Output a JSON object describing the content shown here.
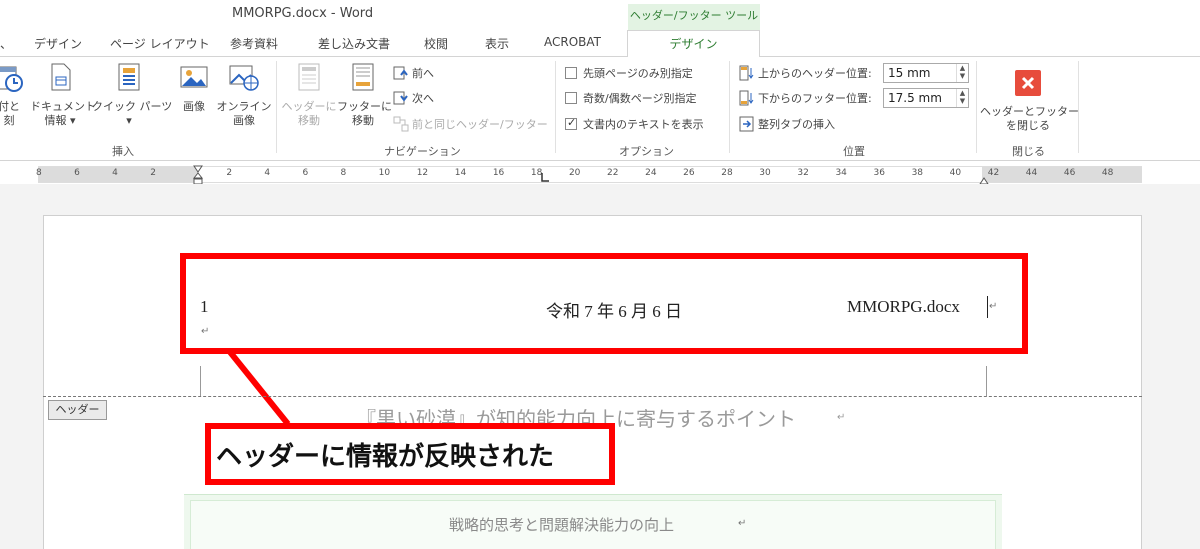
{
  "window": {
    "title": "MMORPG.docx - Word",
    "context_tab_label": "ヘッダー/フッター ツール"
  },
  "tabs": [
    "デザイン",
    "ページ レイアウト",
    "参考資料",
    "差し込み文書",
    "校閲",
    "表示",
    "ACROBAT",
    "デザイン"
  ],
  "ribbon": {
    "insert": {
      "label": "挿入",
      "date_time": "付と\n刻",
      "doc_info": "ドキュメント\n情報 ▾",
      "quick_parts": "クイック パーツ\n▾",
      "picture": "画像",
      "online_picture": "オンライン\n画像"
    },
    "navigation": {
      "label": "ナビゲーション",
      "goto_header": "ヘッダーに\n移動",
      "goto_footer": "フッターに\n移動",
      "previous": "前へ",
      "next": "次へ",
      "link_previous": "前と同じヘッダー/フッター"
    },
    "options": {
      "label": "オプション",
      "different_first_page": "先頭ページのみ別指定",
      "different_odd_even": "奇数/偶数ページ別指定",
      "show_document_text": "文書内のテキストを表示"
    },
    "position": {
      "label": "位置",
      "header_from_top_label": "上からのヘッダー位置:",
      "header_from_top_value": "15 mm",
      "footer_from_bottom_label": "下からのフッター位置:",
      "footer_from_bottom_value": "17.5 mm",
      "insert_alignment_tab": "整列タブの挿入"
    },
    "close": {
      "label": "閉じる",
      "close_button": "ヘッダーとフッター\nを閉じる"
    }
  },
  "ruler": {
    "ticks": [
      "8",
      "6",
      "4",
      "2",
      "2",
      "4",
      "6",
      "8",
      "10",
      "12",
      "14",
      "16",
      "18",
      "20",
      "22",
      "24",
      "26",
      "28",
      "30",
      "32",
      "34",
      "36",
      "38",
      "40",
      "42",
      "44",
      "46",
      "48"
    ]
  },
  "document": {
    "header": {
      "page_number": "1",
      "date": "令和 7 年 6 月 6 日",
      "filename": "MMORPG.docx"
    },
    "header_tag": "ヘッダー",
    "body_title": "『黒い砂漠』が知的能力向上に寄与するポイント",
    "subheading": "戦略的思考と問題解決能力の向上"
  },
  "annotation": {
    "callout": "ヘッダーに情報が反映された",
    "highlight_color": "#ff0000"
  },
  "colors": {
    "accent_green": "#2e7d32",
    "close_red": "#e74c3c"
  }
}
